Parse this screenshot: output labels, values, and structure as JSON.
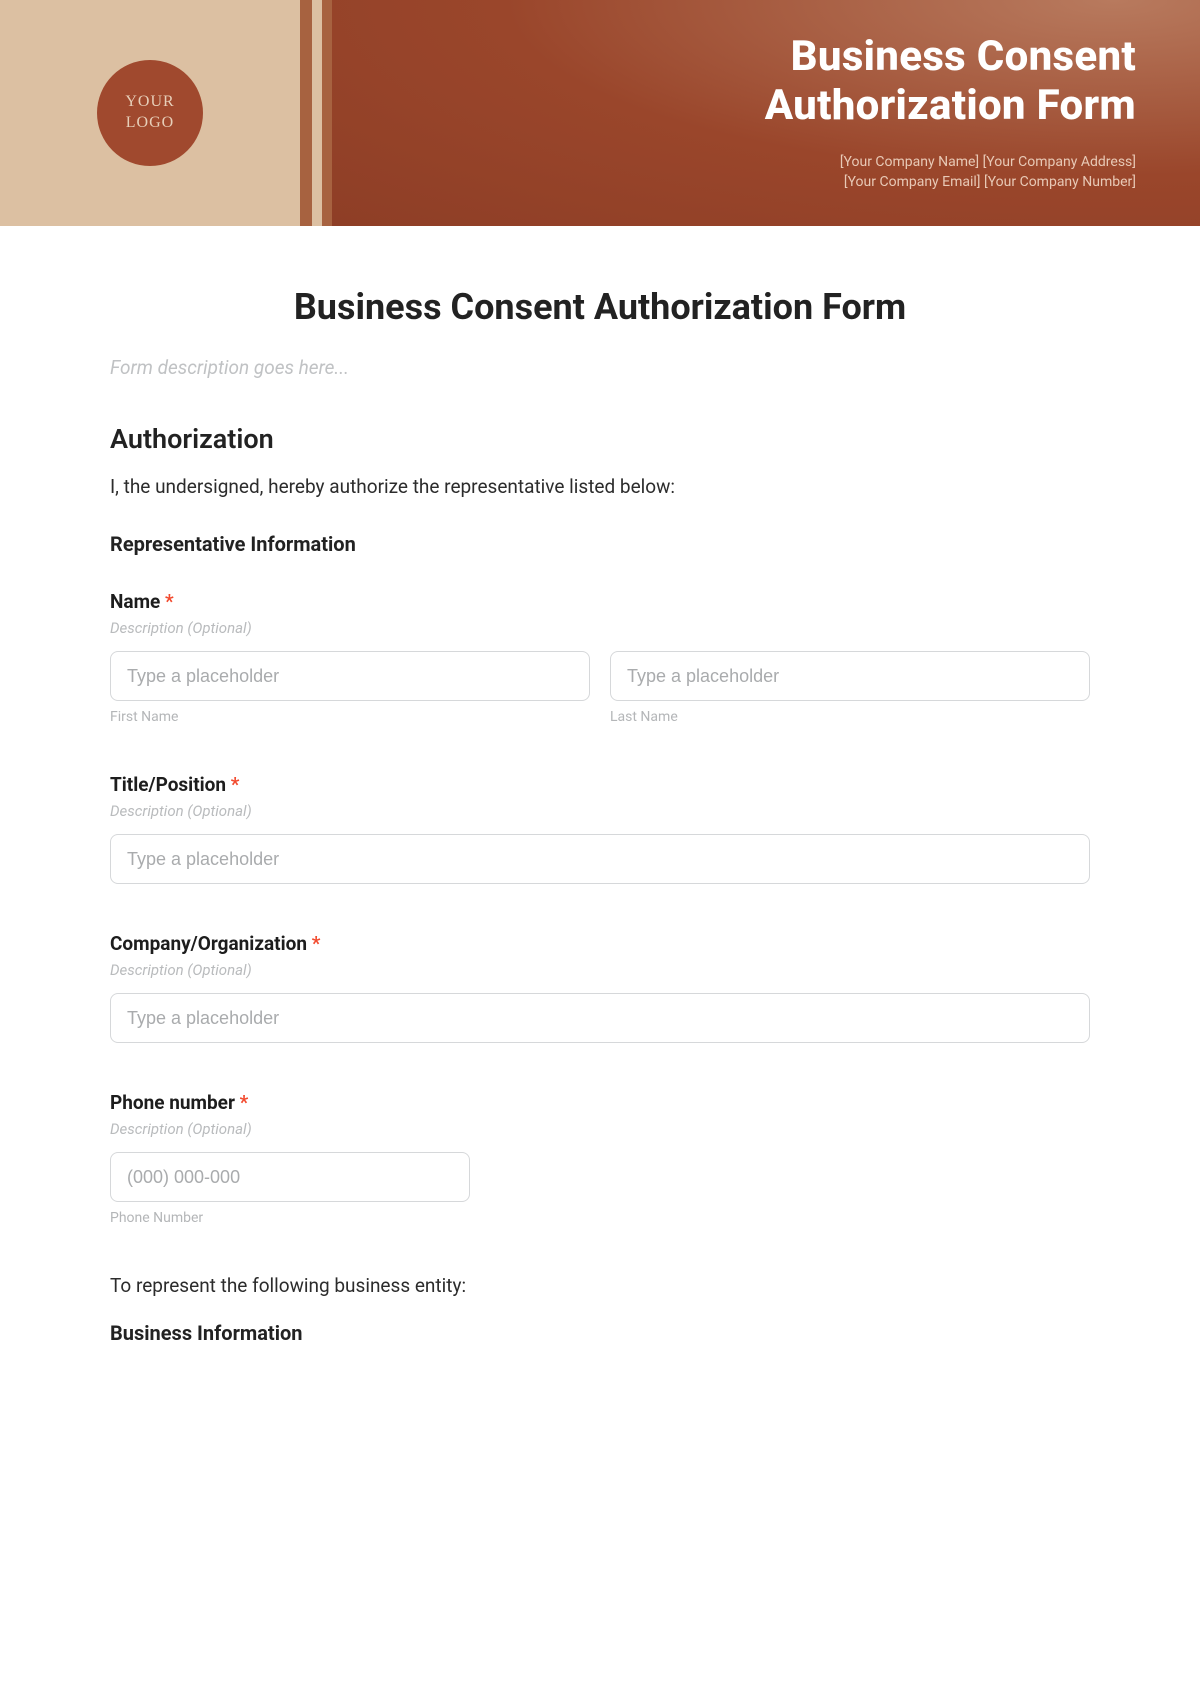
{
  "banner": {
    "logo_line1": "YOUR",
    "logo_line2": "LOGO",
    "title_line1": "Business Consent",
    "title_line2": "Authorization Form",
    "meta_line1": "[Your Company Name] [Your Company Address]",
    "meta_line2": "[Your Company Email] [Your Company Number]"
  },
  "form": {
    "title": "Business Consent Authorization Form",
    "description_placeholder": "Form description goes here...",
    "authorization": {
      "heading": "Authorization",
      "text": "I, the undersigned, hereby authorize the representative listed below:",
      "rep_heading": "Representative Information"
    },
    "fields": {
      "name": {
        "label": "Name",
        "required_mark": "*",
        "desc": "Description (Optional)",
        "first_placeholder": "Type a placeholder",
        "first_sub": "First Name",
        "last_placeholder": "Type a placeholder",
        "last_sub": "Last Name"
      },
      "title_position": {
        "label": "Title/Position",
        "required_mark": "*",
        "desc": "Description (Optional)",
        "placeholder": "Type a placeholder"
      },
      "company": {
        "label": "Company/Organization",
        "required_mark": "*",
        "desc": "Description (Optional)",
        "placeholder": "Type a placeholder"
      },
      "phone": {
        "label": "Phone number",
        "required_mark": "*",
        "desc": "Description (Optional)",
        "placeholder": "(000) 000-000",
        "sub": "Phone Number"
      }
    },
    "entity_text": "To represent the following business entity:",
    "business_info_heading": "Business Information"
  }
}
